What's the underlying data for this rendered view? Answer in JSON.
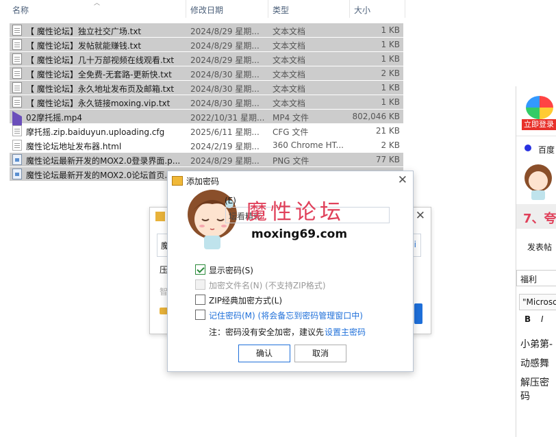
{
  "columns": {
    "name": "名称",
    "date": "修改日期",
    "type": "类型",
    "size": "大小"
  },
  "files": [
    {
      "name": "【 魔性论坛】独立社交广场.txt",
      "date": "2024/8/29 星期...",
      "type": "文本文档",
      "size": "1 KB",
      "icon": "text-file-icon",
      "selected": true
    },
    {
      "name": "【 魔性论坛】发帖就能赚钱.txt",
      "date": "2024/8/29 星期...",
      "type": "文本文档",
      "size": "1 KB",
      "icon": "text-file-icon",
      "selected": true
    },
    {
      "name": "【 魔性论坛】几十万部视频在线观看.txt",
      "date": "2024/8/29 星期...",
      "type": "文本文档",
      "size": "1 KB",
      "icon": "text-file-icon",
      "selected": true
    },
    {
      "name": "【 魔性论坛】全免费-无套路-更新快.txt",
      "date": "2024/8/30 星期...",
      "type": "文本文档",
      "size": "2 KB",
      "icon": "text-file-icon",
      "selected": true
    },
    {
      "name": "【 魔性论坛】永久地址发布页及邮箱.txt",
      "date": "2024/8/30 星期...",
      "type": "文本文档",
      "size": "1 KB",
      "icon": "text-file-icon",
      "selected": true
    },
    {
      "name": "【 魔性论坛】永久链接moxing.vip.txt",
      "date": "2024/8/30 星期...",
      "type": "文本文档",
      "size": "1 KB",
      "icon": "text-file-icon",
      "selected": true
    },
    {
      "name": "02摩托摇.mp4",
      "date": "2022/10/31 星期...",
      "type": "MP4 文件",
      "size": "802,046 KB",
      "icon": "video-file-icon",
      "selected": true
    },
    {
      "name": "摩托摇.zip.baiduyun.uploading.cfg",
      "date": "2025/6/11 星期...",
      "type": "CFG 文件",
      "size": "21 KB",
      "icon": "cfg-file-icon",
      "selected": false
    },
    {
      "name": "魔性论坛地址发布器.html",
      "date": "2024/2/19 星期...",
      "type": "360 Chrome HT...",
      "size": "2 KB",
      "icon": "html-file-icon",
      "selected": false
    },
    {
      "name": "魔性论坛最新开发的MOX2.0登录界面.p...",
      "date": "2024/8/29 星期...",
      "type": "PNG 文件",
      "size": "77 KB",
      "icon": "image-file-icon",
      "selected": true
    },
    {
      "name": "魔性论坛最新开发的MOX2.0论坛首页.",
      "date": "",
      "type": "",
      "size": "",
      "icon": "image-file-icon",
      "selected": true
    }
  ],
  "bg_dialog": {
    "field_prefix": "魔",
    "compress_label": "压",
    "smart_label": "智",
    "hint": "i"
  },
  "dialog": {
    "title": "添加密码",
    "close": "✕",
    "password_label": "(E)",
    "password_value": "坛看精彩",
    "watermark_title": "魔性论坛",
    "watermark_url": "moxing69.com",
    "options": {
      "show_password": "显示密码(S)",
      "encrypt_names": "加密文件名(N) (不支持ZIP格式)",
      "zip_classic": "ZIP经典加密方式(L)",
      "remember": "记住密码(M) (将会备忘到密码管理窗口中)"
    },
    "note_prefix": "注：密码没有安全加密，建议先",
    "note_link": "设置主密码",
    "ok": "确认",
    "cancel": "取消",
    "show_password_checked": true
  },
  "right_window": {
    "login_badge": "立即登录",
    "baidu": "百度",
    "banner_text": "7、夸",
    "tab": "发表帖",
    "font_size": "福利",
    "font_name": "\"Microso",
    "bold": "B",
    "italic": "I",
    "line1": "小弟第-",
    "line2": "动感舞",
    "line3": "解压密码"
  },
  "colors": {
    "selection": "#cccccc",
    "accent": "#1e6fd9",
    "watermark": "#e0405a",
    "check": "#2a8a3a"
  }
}
